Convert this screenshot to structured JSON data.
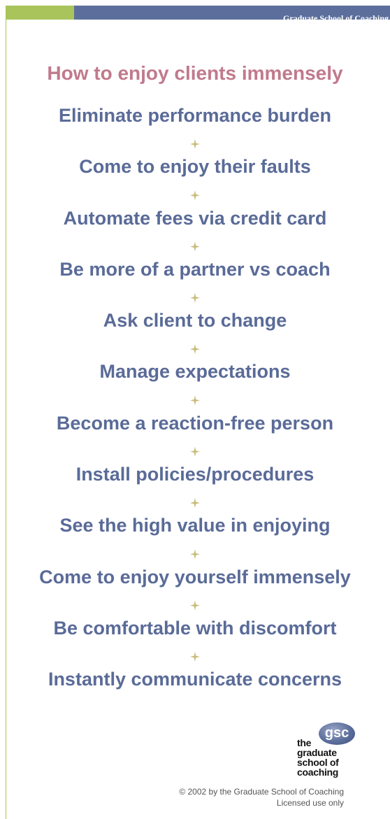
{
  "header": {
    "org_name": "Graduate School of Coaching",
    "accent_green": "#a8c45a",
    "accent_blue": "#5c6f9c"
  },
  "title": "How to enjoy clients immensely",
  "tips": [
    "Eliminate performance burden",
    "Come to enjoy their faults",
    "Automate fees via credit card",
    "Be more of a partner vs coach",
    "Ask client to change",
    "Manage expectations",
    "Become a reaction-free person",
    "Install policies/procedures",
    "See the high value in enjoying",
    "Come to enjoy yourself immensely",
    "Be comfortable with discomfort",
    "Instantly communicate concerns"
  ],
  "logo": {
    "badge": "gsc",
    "lines": [
      "the",
      "graduate",
      "school of",
      "coaching"
    ]
  },
  "footer": {
    "copyright": "© 2002 by the Graduate School of Coaching",
    "license": "Licensed use only"
  },
  "colors": {
    "title": "#c07a8c",
    "tip_text": "#5a6b98",
    "separator": "#c9bc7a"
  }
}
